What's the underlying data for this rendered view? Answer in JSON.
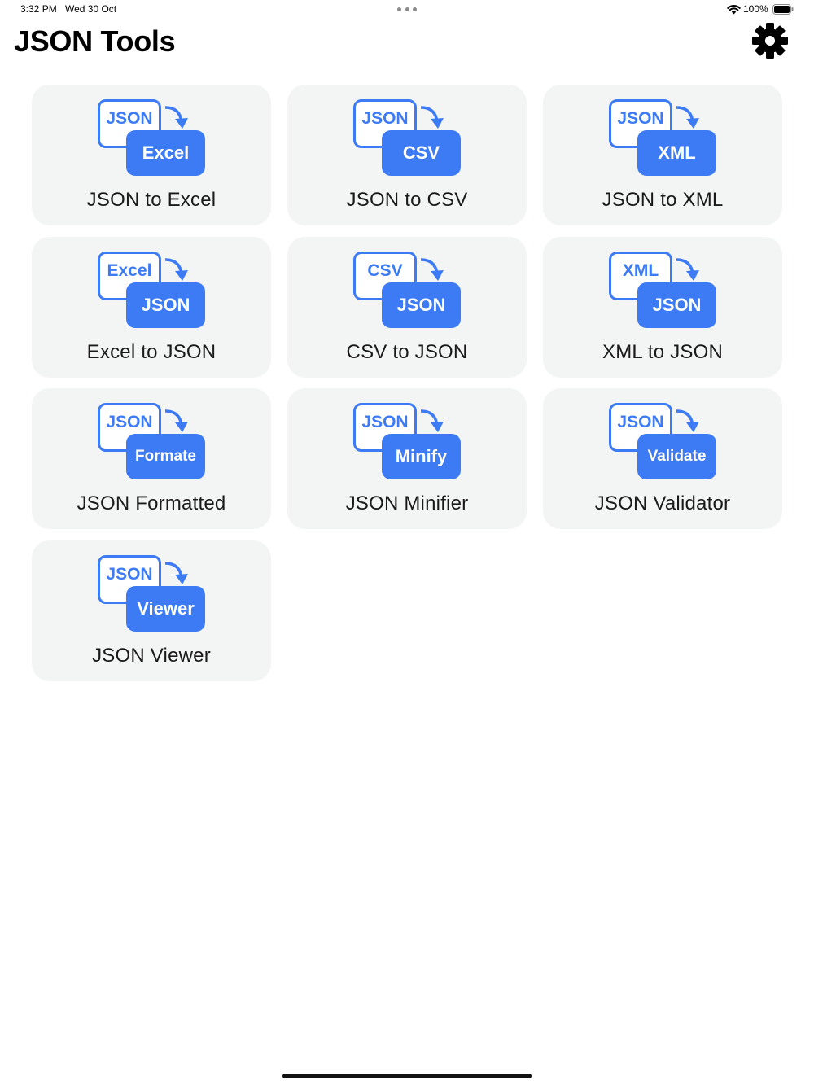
{
  "status_bar": {
    "time": "3:32 PM",
    "date": "Wed 30 Oct",
    "battery_percent": "100%"
  },
  "header": {
    "title": "JSON Tools",
    "settings_icon": "gear-icon"
  },
  "colors": {
    "accent": "#3d7bf5",
    "tile_background": "#f3f4f4"
  },
  "tools": [
    {
      "label": "JSON to Excel",
      "from": "JSON",
      "to": "Excel"
    },
    {
      "label": "JSON to CSV",
      "from": "JSON",
      "to": "CSV"
    },
    {
      "label": "JSON to XML",
      "from": "JSON",
      "to": "XML"
    },
    {
      "label": "Excel to JSON",
      "from": "Excel",
      "to": "JSON"
    },
    {
      "label": "CSV to JSON",
      "from": "CSV",
      "to": "JSON"
    },
    {
      "label": "XML to JSON",
      "from": "XML",
      "to": "JSON"
    },
    {
      "label": "JSON Formatted",
      "from": "JSON",
      "to": "Formate"
    },
    {
      "label": "JSON Minifier",
      "from": "JSON",
      "to": "Minify"
    },
    {
      "label": "JSON Validator",
      "from": "JSON",
      "to": "Validate"
    },
    {
      "label": "JSON Viewer",
      "from": "JSON",
      "to": "Viewer"
    }
  ]
}
